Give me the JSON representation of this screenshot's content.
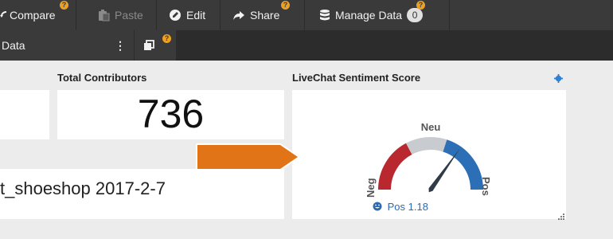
{
  "toolbar": {
    "compare_label": "Compare",
    "paste_label": "Paste",
    "edit_label": "Edit",
    "share_label": "Share",
    "manage_data_label": "Manage Data",
    "manage_data_count": "0",
    "help_marker": "?"
  },
  "subbar": {
    "title": "Data",
    "menu_glyph": "⋮"
  },
  "cards": {
    "contributors": {
      "title": "Total Contributors",
      "value": "736"
    },
    "dataset": {
      "text": "t_shoeshop 2017-2-7"
    },
    "sentiment": {
      "title": "LiveChat Sentiment Score",
      "gauge": {
        "neg_label": "Neg",
        "neu_label": "Neu",
        "pos_label": "Pos",
        "value": 1.18,
        "min": -3,
        "max": 3
      },
      "score_text": "Pos 1.18"
    }
  },
  "colors": {
    "neg": "#b8282e",
    "neu": "#c8ccd0",
    "pos": "#2c6fb7",
    "arrow": "#e07416",
    "score_text": "#2d6ab0"
  },
  "icons": {
    "compare": "compare-icon",
    "paste": "paste-icon",
    "edit": "edit-icon",
    "share": "share-icon",
    "manage_data": "database-icon",
    "clone": "clone-icon",
    "settings": "gear-icon",
    "score": "smiley-icon",
    "resize": "resize-handle-icon"
  }
}
